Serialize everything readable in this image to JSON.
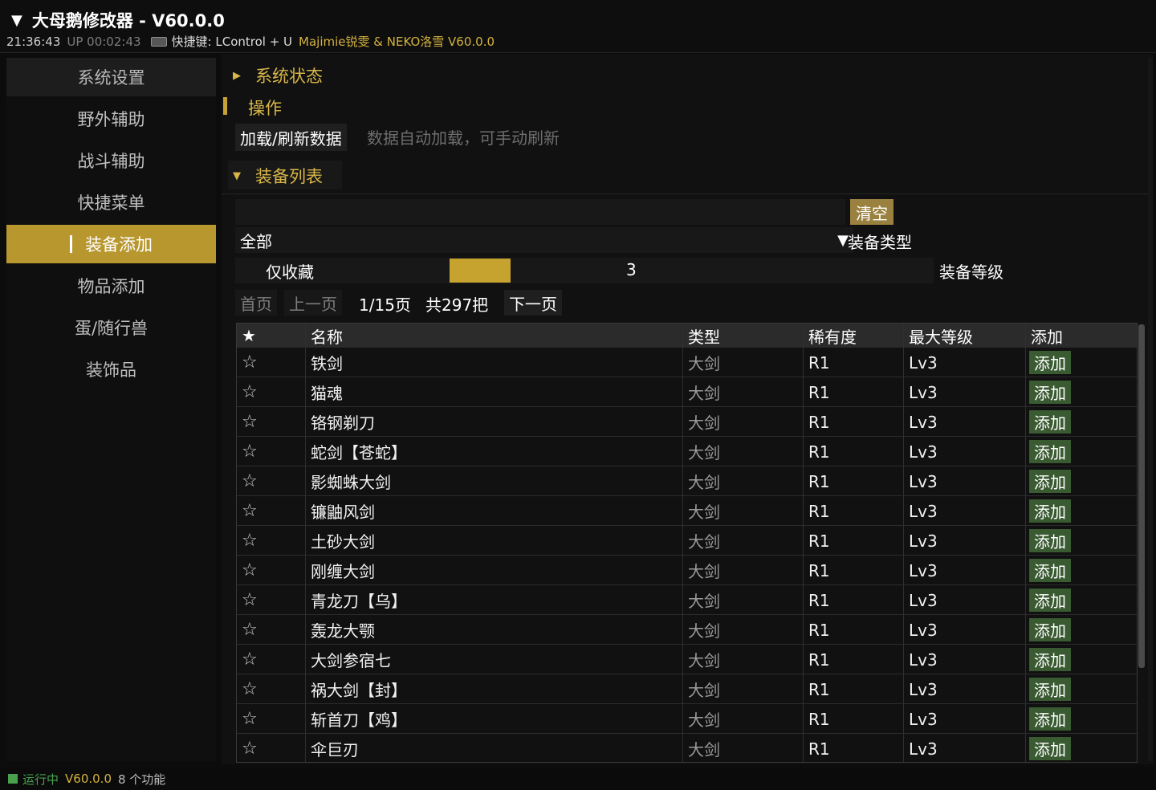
{
  "window": {
    "title": "大母鹅修改器 - V60.0.0",
    "clock": "21:36:43",
    "uptime": "UP 00:02:43",
    "hotkey": "快捷键: LControl + U",
    "authors": "Majimie锐雯 & NEKO洛雪 V60.0.0"
  },
  "sidebar": {
    "items": [
      {
        "label": "系统设置"
      },
      {
        "label": "野外辅助"
      },
      {
        "label": "战斗辅助"
      },
      {
        "label": "快捷菜单"
      },
      {
        "label": "装备添加"
      },
      {
        "label": "物品添加"
      },
      {
        "label": "蛋/随行兽"
      },
      {
        "label": "装饰品"
      }
    ]
  },
  "main": {
    "system_status": "系统状态",
    "operations": "操作",
    "reload_button": "加载/刷新数据",
    "reload_hint": "数据自动加载，可手动刷新",
    "equip_list": "装备列表",
    "search_value": "",
    "clear_button": "清空",
    "type_value": "全部",
    "type_label": "装备类型",
    "favorites_only": "仅收藏",
    "level_value": "3",
    "level_label": "装备等级",
    "pager": {
      "first": "首页",
      "prev": "上一页",
      "page_info": "1/15页",
      "total": "共297把",
      "next": "下一页"
    },
    "table": {
      "headers": [
        "★",
        "名称",
        "类型",
        "稀有度",
        "最大等级",
        "添加"
      ],
      "rows": [
        {
          "star": "☆",
          "name": "铁剑",
          "type": "大剑",
          "rarity": "R1",
          "max_level": "Lv3",
          "add": "添加"
        },
        {
          "star": "☆",
          "name": "猫魂",
          "type": "大剑",
          "rarity": "R1",
          "max_level": "Lv3",
          "add": "添加"
        },
        {
          "star": "☆",
          "name": "铬钢剃刀",
          "type": "大剑",
          "rarity": "R1",
          "max_level": "Lv3",
          "add": "添加"
        },
        {
          "star": "☆",
          "name": "蛇剑【苍蛇】",
          "type": "大剑",
          "rarity": "R1",
          "max_level": "Lv3",
          "add": "添加"
        },
        {
          "star": "☆",
          "name": "影蜘蛛大剑",
          "type": "大剑",
          "rarity": "R1",
          "max_level": "Lv3",
          "add": "添加"
        },
        {
          "star": "☆",
          "name": "镰鼬风剑",
          "type": "大剑",
          "rarity": "R1",
          "max_level": "Lv3",
          "add": "添加"
        },
        {
          "star": "☆",
          "name": "土砂大剑",
          "type": "大剑",
          "rarity": "R1",
          "max_level": "Lv3",
          "add": "添加"
        },
        {
          "star": "☆",
          "name": "刚缠大剑",
          "type": "大剑",
          "rarity": "R1",
          "max_level": "Lv3",
          "add": "添加"
        },
        {
          "star": "☆",
          "name": "青龙刀【乌】",
          "type": "大剑",
          "rarity": "R1",
          "max_level": "Lv3",
          "add": "添加"
        },
        {
          "star": "☆",
          "name": "轰龙大颚",
          "type": "大剑",
          "rarity": "R1",
          "max_level": "Lv3",
          "add": "添加"
        },
        {
          "star": "☆",
          "name": "大剑参宿七",
          "type": "大剑",
          "rarity": "R1",
          "max_level": "Lv3",
          "add": "添加"
        },
        {
          "star": "☆",
          "name": "祸大剑【封】",
          "type": "大剑",
          "rarity": "R1",
          "max_level": "Lv3",
          "add": "添加"
        },
        {
          "star": "☆",
          "name": "斩首刀【鸡】",
          "type": "大剑",
          "rarity": "R1",
          "max_level": "Lv3",
          "add": "添加"
        },
        {
          "star": "☆",
          "name": "伞巨刃",
          "type": "大剑",
          "rarity": "R1",
          "max_level": "Lv3",
          "add": "添加"
        }
      ]
    }
  },
  "status": {
    "state": "运行中",
    "version": "V60.0.0",
    "features": "8 个功能"
  },
  "colors": {
    "accent": "#b8972f",
    "gold_text": "#d8b647",
    "add_button": "#3a5a32",
    "running": "#49a14e"
  }
}
